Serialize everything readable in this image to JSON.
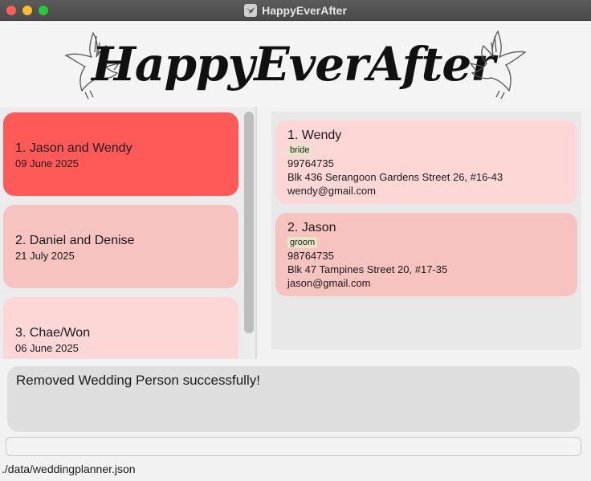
{
  "window": {
    "title": "HappyEverAfter"
  },
  "banner": {
    "logo_text": "HappyEverAfter"
  },
  "weddings": [
    {
      "title": "1. Jason and Wendy",
      "date": "09 June 2025",
      "color": "#ff5a57"
    },
    {
      "title": "2. Daniel and Denise",
      "date": "21 July 2025",
      "color": "#f6c3c1"
    },
    {
      "title": "3. Chae/Won",
      "date": "06 June 2025",
      "color": "#fdd6d6"
    }
  ],
  "persons": [
    {
      "name": "1. Wendy",
      "tag": "bride",
      "phone": "99764735",
      "address": "Blk 436 Serangoon Gardens Street 26, #16-43",
      "email": "wendy@gmail.com"
    },
    {
      "name": "2. Jason",
      "tag": "groom",
      "phone": "98764735",
      "address": "Blk 47 Tampines Street 20, #17-35",
      "email": "jason@gmail.com"
    }
  ],
  "result": {
    "message": "Removed Wedding Person successfully!"
  },
  "command": {
    "value": ""
  },
  "status": {
    "file_path": "./data/weddingplanner.json"
  },
  "colors": {
    "selected_wedding": "#ff5a57",
    "card_pink": "#fdd6d6",
    "card_rose": "#f6c3c1",
    "tag_bg": "#e5e6c8"
  }
}
